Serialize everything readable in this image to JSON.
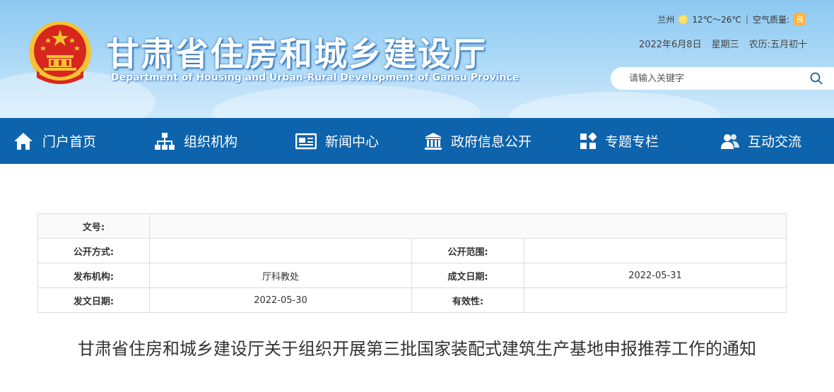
{
  "header": {
    "title": "甘肃省住房和城乡建设厅",
    "subtitle": "Department of Housing and Urban-Rural Development of Gansu Province",
    "weather": {
      "city": "兰州",
      "icon": "sun-icon",
      "temp": "12℃～26℃",
      "separator": "|",
      "aq_label": "空气质量:",
      "aq_value": "良"
    },
    "date": {
      "gregorian": "2022年6月8日",
      "weekday": "星期三",
      "lunar": "农历:五月初十"
    },
    "search": {
      "placeholder": "请输入关键字"
    }
  },
  "nav": {
    "items": [
      {
        "label": "门户首页",
        "icon": "home-icon"
      },
      {
        "label": "组织机构",
        "icon": "org-chart-icon"
      },
      {
        "label": "新闻中心",
        "icon": "newspaper-icon"
      },
      {
        "label": "政府信息公开",
        "icon": "government-building-icon"
      },
      {
        "label": "专题专栏",
        "icon": "grid-icon"
      },
      {
        "label": "互动交流",
        "icon": "users-icon"
      }
    ]
  },
  "meta": {
    "doc_no_label": "文号:",
    "doc_no_value": "",
    "disclosure_method_label": "公开方式:",
    "disclosure_method_value": "",
    "disclosure_scope_label": "公开范围:",
    "disclosure_scope_value": "",
    "issuer_label": "发布机构:",
    "issuer_value": "厅科教处",
    "written_date_label": "成文日期:",
    "written_date_value": "2022-05-31",
    "issue_date_label": "发文日期:",
    "issue_date_value": "2022-05-30",
    "validity_label": "有效性:",
    "validity_value": ""
  },
  "article": {
    "title": "甘肃省住房和城乡建设厅关于组织开展第三批国家装配式建筑生产基地申报推荐工作的通知"
  },
  "colors": {
    "nav_bg": "#0d63ac",
    "header_sky": "#a8d7f6",
    "emblem_red": "#d7261e",
    "emblem_gold": "#f6c233"
  }
}
